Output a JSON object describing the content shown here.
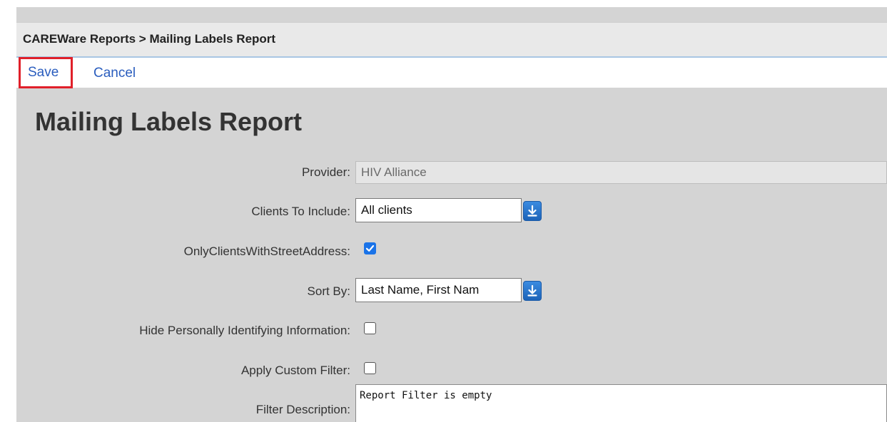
{
  "breadcrumb": "CAREWare Reports > Mailing Labels Report",
  "toolbar": {
    "save_label": "Save",
    "cancel_label": "Cancel"
  },
  "page_title": "Mailing Labels Report",
  "form": {
    "provider": {
      "label": "Provider:",
      "value": "HIV Alliance"
    },
    "clients_to_include": {
      "label": "Clients To Include:",
      "value": "All clients"
    },
    "only_clients_with_street_address": {
      "label": "OnlyClientsWithStreetAddress:",
      "checked": true
    },
    "sort_by": {
      "label": "Sort By:",
      "value": "Last Name, First Nam"
    },
    "hide_pii": {
      "label": "Hide Personally Identifying Information:",
      "checked": false
    },
    "apply_custom_filter": {
      "label": "Apply Custom Filter:",
      "checked": false
    },
    "filter_description": {
      "label": "Filter Description:",
      "value": "Report Filter is empty"
    }
  },
  "icons": {
    "dropdown": "arrow-down-to-line-icon",
    "checkmark": "checkmark-icon"
  },
  "colors": {
    "link": "#2a5dbe",
    "save_highlight": "#e0202a",
    "dropdown_button": "#1c63b8",
    "checkbox_checked": "#1a73e8"
  }
}
